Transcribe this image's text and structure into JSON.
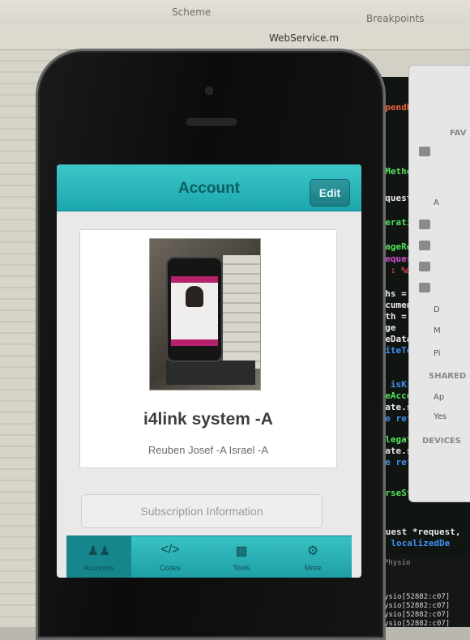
{
  "background": {
    "toolbar_items": [
      "Scheme",
      "Breakpoints"
    ],
    "file_tabs": [
      "WebService.m"
    ],
    "code_lines": [
      {
        "text": "appendPar",
        "color": "#f05e3f"
      },
      {
        "text": "TPMethod:",
        "color": "#53e35e"
      },
      {
        "text": "request =",
        "color": "#e8e8e8"
      },
      {
        "text": "Operation",
        "color": "#53e35e"
      },
      {
        "text": "ImageReque",
        "color": "#53e35e"
      },
      {
        "text": "lRequest",
        "color": "#d44fd1"
      },
      {
        "text": "ge : %@",
        "color": "#e24b4b"
      },
      {
        "text": "aths = NS",
        "color": "#e8e8e8"
      },
      {
        "text": "documents",
        "color": "#e8e8e8"
      },
      {
        "text": "path = [d",
        "color": "#e8e8e8"
      },
      {
        "text": "nage",
        "color": "#e8e8e8"
      },
      {
        "text": "ageData =",
        "color": "#e8e8e8"
      },
      {
        "text": "writeTof",
        "color": "#3f8ff0"
      },
      {
        "text": "te isKind",
        "color": "#3f8ff0"
      },
      {
        "text": "iceAccoun",
        "color": "#53e35e"
      },
      {
        "text": "egate.suc",
        "color": "#e8e8e8"
      },
      {
        "text": "ate refre",
        "color": "#3f8ff0"
      },
      {
        "text": "delegate",
        "color": "#53e35e"
      },
      {
        "text": "egate.suc",
        "color": "#e8e8e8"
      },
      {
        "text": "ate refre",
        "color": "#3f8ff0"
      },
      {
        "text": "parseStri",
        "color": "#53e35e"
      },
      {
        "text": "URLRequest *request,",
        "color": "#e8e8e8"
      },
      {
        "text": "(error localizedDe",
        "color": "#3f8ff0"
      }
    ],
    "sidebar": {
      "heading_fav": "FAV",
      "heading_shared": "SHARED",
      "heading_devices": "DEVICES",
      "items_fav": [
        "A",
        "D",
        "M",
        "Pi"
      ],
      "items_shared": [
        "Ap",
        "Yes"
      ]
    },
    "console_lines": [
      "SmartPhysio[52882:c07]",
      "SmartPhysio[52882:c07]",
      "SmartPhysio[52882:c07]",
      "SmartPhysio[52882:c07]"
    ],
    "console_header": "> SmartPhysio"
  },
  "app": {
    "nav_title": "Account",
    "edit_label": "Edit",
    "name": "i4link system -A",
    "subtitle": "Reuben Josef -A Israel -A",
    "subscription_label": "Subscription Information",
    "tabs": [
      {
        "label": "Accounts",
        "icon": "users-icon"
      },
      {
        "label": "Codes",
        "icon": "code-icon"
      },
      {
        "label": "Tools",
        "icon": "tools-icon"
      },
      {
        "label": "More",
        "icon": "gear-icon"
      }
    ],
    "accent_color": "#2bb6bb"
  }
}
